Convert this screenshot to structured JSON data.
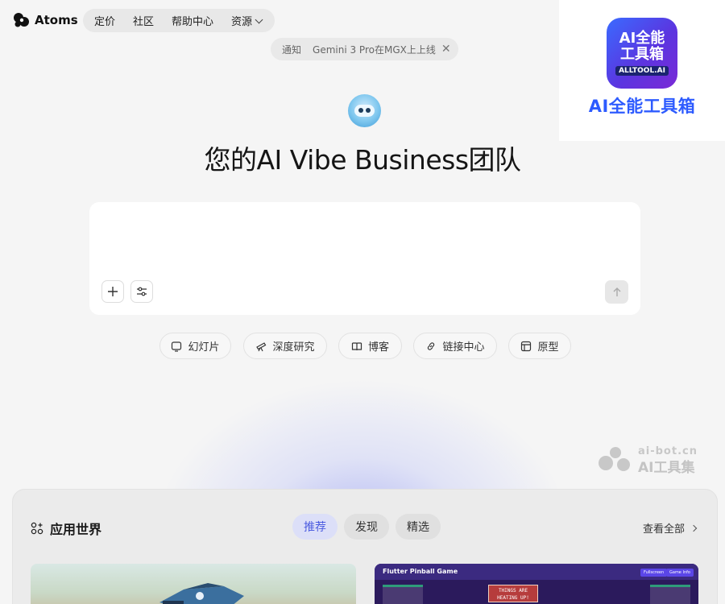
{
  "header": {
    "brand": "Atoms",
    "nav": [
      {
        "label": "定价"
      },
      {
        "label": "社区"
      },
      {
        "label": "帮助中心"
      },
      {
        "label": "资源"
      }
    ]
  },
  "notice": {
    "tag": "通知",
    "text": "Gemini 3 Pro在MGX上上线"
  },
  "promo": {
    "tile_line1": "AI全能",
    "tile_line2": "工具箱",
    "tile_badge": "ALLTOOL.AI",
    "caption": "AI全能工具箱"
  },
  "hero": {
    "title": "您的AI Vibe Business团队"
  },
  "composer": {
    "placeholder": ""
  },
  "chips": [
    {
      "label": "幻灯片",
      "icon": "slides-icon"
    },
    {
      "label": "深度研究",
      "icon": "telescope-icon"
    },
    {
      "label": "博客",
      "icon": "book-icon"
    },
    {
      "label": "链接中心",
      "icon": "link-icon"
    },
    {
      "label": "原型",
      "icon": "layout-icon"
    }
  ],
  "watermark": {
    "domain": "ai-bot.cn",
    "name": "AI工具集"
  },
  "app_world": {
    "title": "应用世界",
    "tabs": [
      {
        "label": "推荐",
        "active": true
      },
      {
        "label": "发现",
        "active": false
      },
      {
        "label": "精选",
        "active": false
      }
    ],
    "view_all": "查看全部",
    "cards": [
      {
        "title": ""
      },
      {
        "title": "Flutter Pinball Game",
        "btn1": "Fullscreen",
        "btn2": "Game Info",
        "sign": "THINGS ARE HEATING UP!"
      }
    ]
  },
  "colors": {
    "accent": "#4b5be0",
    "page_bg": "#f5f5f5",
    "promo_blue": "#2d5bff"
  }
}
